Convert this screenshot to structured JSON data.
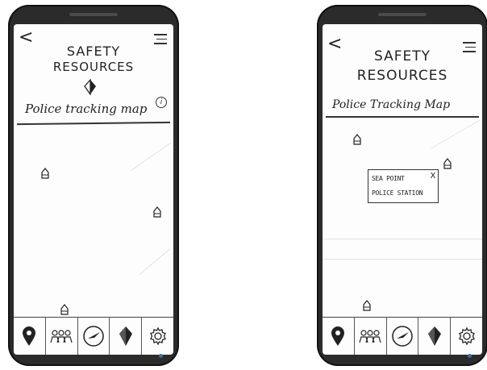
{
  "screens": [
    {
      "title_line1": "SAFETY",
      "title_line2": "RESOURCES",
      "map_title": "Police tracking map",
      "info_icon": "i",
      "back_icon": "<",
      "nav": [
        "location-pin-icon",
        "people-icon",
        "compass-icon",
        "shield-icon",
        "gear-icon"
      ]
    },
    {
      "title_line1": "SAFETY",
      "title_line2": "RESOURCES",
      "map_title": "Police Tracking Map",
      "back_icon": "<",
      "popup": {
        "line1": "SEA POINT",
        "line2": "POLICE STATION",
        "close": "X"
      },
      "nav": [
        "location-pin-icon",
        "people-icon",
        "compass-icon",
        "shield-icon",
        "gear-icon"
      ]
    }
  ]
}
